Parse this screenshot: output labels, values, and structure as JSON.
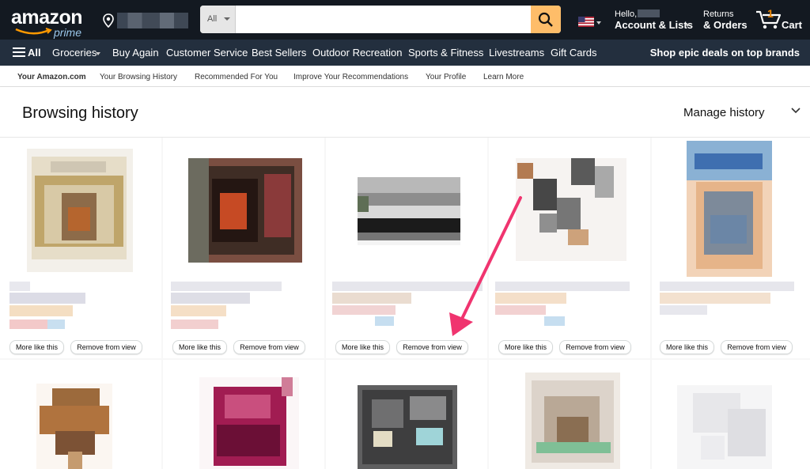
{
  "header": {
    "logo_text": "amazon",
    "logo_sub": "prime",
    "search_category": "All",
    "search_value": "",
    "hello": "Hello,",
    "account": "Account & Lists",
    "returns": "Returns",
    "orders": "& Orders",
    "cart_count": "1",
    "cart": "Cart",
    "accent": "#febd69"
  },
  "subnav": {
    "all": "All",
    "items": [
      "Groceries",
      "Buy Again",
      "Customer Service",
      "Best Sellers",
      "Outdoor Recreation",
      "Sports & Fitness",
      "Livestreams",
      "Gift Cards"
    ],
    "promo": "Shop epic deals on top brands"
  },
  "tabs": [
    "Your Amazon.com",
    "Your Browsing History",
    "Recommended For You",
    "Improve Your Recommendations",
    "Your Profile",
    "Learn More"
  ],
  "page": {
    "title": "Browsing history",
    "manage": "Manage history"
  },
  "card_actions": {
    "more_like_this": "More like this",
    "remove_from_view": "Remove from view"
  },
  "colors": {
    "annotation_arrow": "#f0346f"
  }
}
